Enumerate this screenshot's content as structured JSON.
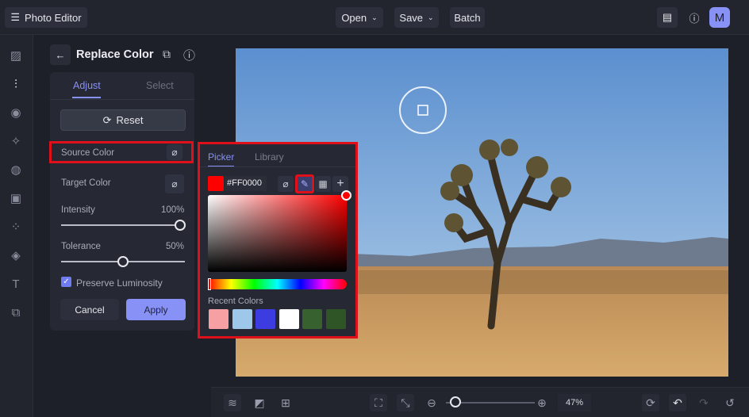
{
  "header": {
    "app_title": "Photo Editor",
    "open": "Open",
    "save": "Save",
    "batch": "Batch",
    "avatar": "M"
  },
  "panel": {
    "title": "Replace Color",
    "tabs": [
      "Adjust",
      "Select"
    ],
    "reset": "Reset",
    "source_color": "Source Color",
    "target_color": "Target Color",
    "intensity_label": "Intensity",
    "intensity_value": "100%",
    "intensity": 100,
    "tolerance_label": "Tolerance",
    "tolerance_value": "50%",
    "tolerance": 50,
    "preserve_luminosity": "Preserve Luminosity",
    "preserve_checked": true,
    "cancel": "Cancel",
    "apply": "Apply"
  },
  "picker": {
    "tabs": [
      "Picker",
      "Library"
    ],
    "hex": "#FF0000",
    "recent_label": "Recent Colors",
    "recent_colors": [
      "#f7a0a4",
      "#9ec8ea",
      "#3c3ce0",
      "#ffffff",
      "#37612f",
      "#2f5426"
    ]
  },
  "footer": {
    "zoom": "47%",
    "zoom_fraction": 0.05
  },
  "colors": {
    "accent": "#8891f5",
    "highlight": "#e0101a"
  }
}
